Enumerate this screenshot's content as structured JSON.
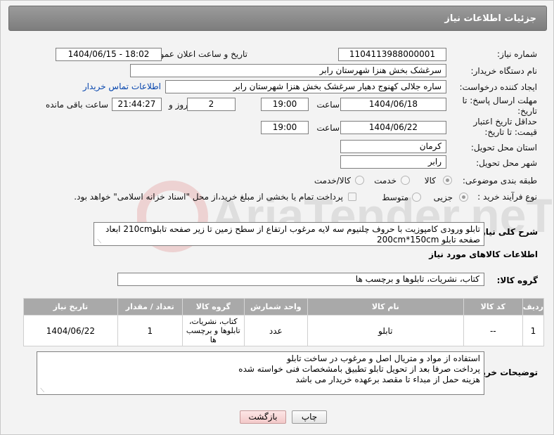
{
  "header": {
    "title": "جزئیات اطلاعات نیاز"
  },
  "labels": {
    "need_number": "شماره نیاز:",
    "announce_datetime": "تاریخ و ساعت اعلان عمومی:",
    "buyer_org": "نام دستگاه خریدار:",
    "requester": "ایجاد کننده درخواست:",
    "deadline": "مهلت ارسال پاسخ: تا تاریخ:",
    "time": "ساعت",
    "day_and": "روز و",
    "hours_remaining": "ساعت باقی مانده",
    "price_validity": "حداقل تاریخ اعتبار قیمت: تا تاریخ:",
    "province": "استان محل تحویل:",
    "city": "شهر محل تحویل:",
    "subject_class": "طبقه بندی موضوعی:",
    "purchase_type": "نوع فرآیند خرید :",
    "description": "شرح کلی نیاز:",
    "goods_info": "اطلاعات کالاهای مورد نیاز",
    "goods_group": "گروه کالا:",
    "buyer_notes": "توضیحات خریدار:"
  },
  "fields": {
    "need_number": "1104113988000001",
    "announce_datetime": "1404/06/15 - 18:02",
    "buyer_org": "سرغشک بخش هنزا شهرستان رابر",
    "requester": "ساره جلالی کهنوج دهیار سرغشک بخش هنزا شهرستان رابر",
    "contact_link": "اطلاعات تماس خریدار",
    "deadline_date": "1404/06/18",
    "deadline_time": "19:00",
    "days": "2",
    "remaining_time": "21:44:27",
    "validity_date": "1404/06/22",
    "validity_time": "19:00",
    "province": "کرمان",
    "city": "رابر",
    "description": "تابلو ورودی کامپوزیت با حروف چلنیوم سه لایه مرغوب ارتفاع از سطح زمین تا زیر صفحه تابلو210cm ابعاد صفحه تابلو 200cm*150cm",
    "goods_group": "کتاب، نشریات، تابلوها و برچسب ها",
    "buyer_notes_1": "استفاده از مواد و متریال اصل و مرغوب در ساخت تابلو",
    "buyer_notes_2": "پرداخت صرفا بعد از تحویل تابلو تطبیق بامشخصات فنی خواسته شده",
    "buyer_notes_3": "هزینه حمل از مبداء تا مقصد برعهده خریدار می باشد"
  },
  "subject_options": {
    "goods": "کالا",
    "service": "خدمت",
    "goods_service": "کالا/خدمت"
  },
  "purchase_options": {
    "partial": "جزیی",
    "medium": "متوسط",
    "treasury_note": "پرداخت تمام یا بخشی از مبلغ خرید،از محل \"اسناد خزانه اسلامی\" خواهد بود."
  },
  "table": {
    "headers": [
      "ردیف",
      "کد کالا",
      "نام کالا",
      "واحد شمارش",
      "گروه کالا",
      "تعداد / مقدار",
      "تاریخ نیاز"
    ],
    "rows": [
      [
        "1",
        "--",
        "تابلو",
        "عدد",
        "کتاب، نشریات، تابلوها و برچسب ها",
        "1",
        "1404/06/22"
      ]
    ]
  },
  "buttons": {
    "print": "چاپ",
    "back": "بازگشت"
  },
  "watermark": {
    "text": "AriaTender.neT"
  }
}
